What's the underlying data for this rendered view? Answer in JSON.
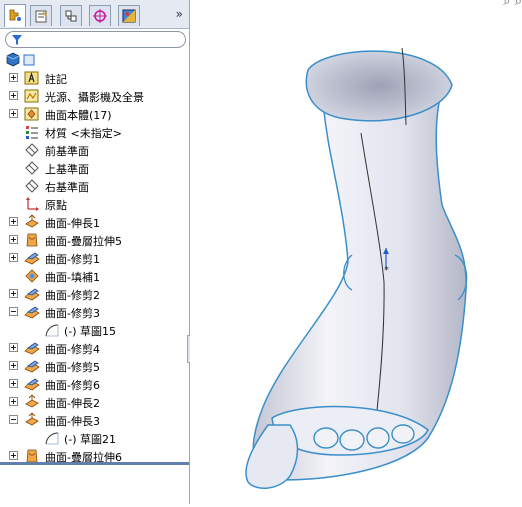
{
  "tabs": [
    {
      "name": "featuremanager",
      "icon": "feature-tree-icon"
    },
    {
      "name": "propertymanager",
      "icon": "property-manager-icon"
    },
    {
      "name": "configurationmanager",
      "icon": "configuration-icon"
    },
    {
      "name": "dimxpert",
      "icon": "target-icon"
    },
    {
      "name": "display",
      "icon": "display-manager-icon"
    }
  ],
  "more_tabs_glyph": "»",
  "tree": [
    {
      "label": "註記",
      "icon": "annotation-icon",
      "expander": "plus"
    },
    {
      "label": "光源、攝影機及全景",
      "icon": "lights-cameras-icon",
      "expander": "plus"
    },
    {
      "label": "曲面本體(17)",
      "icon": "surface-bodies-icon",
      "expander": "plus"
    },
    {
      "label": "材質 <未指定>",
      "icon": "material-icon",
      "expander": "none"
    },
    {
      "label": "前基準面",
      "icon": "plane-icon",
      "expander": "none"
    },
    {
      "label": "上基準面",
      "icon": "plane-icon",
      "expander": "none"
    },
    {
      "label": "右基準面",
      "icon": "plane-icon",
      "expander": "none"
    },
    {
      "label": "原點",
      "icon": "origin-icon",
      "expander": "none"
    },
    {
      "label": "曲面-伸長1",
      "icon": "surface-extrude-icon",
      "expander": "plus"
    },
    {
      "label": "曲面-疊層拉伸5",
      "icon": "surface-loft-icon",
      "expander": "plus"
    },
    {
      "label": "曲面-修剪1",
      "icon": "surface-trim-icon",
      "expander": "plus"
    },
    {
      "label": "曲面-填補1",
      "icon": "surface-fill-icon",
      "expander": "none"
    },
    {
      "label": "曲面-修剪2",
      "icon": "surface-trim-icon",
      "expander": "plus"
    },
    {
      "label": "曲面-修剪3",
      "icon": "surface-trim-icon",
      "expander": "minus"
    },
    {
      "label": "(-) 草圖15",
      "icon": "sketch-icon",
      "expander": "none",
      "indent": 1
    },
    {
      "label": "曲面-修剪4",
      "icon": "surface-trim-icon",
      "expander": "plus"
    },
    {
      "label": "曲面-修剪5",
      "icon": "surface-trim-icon",
      "expander": "plus"
    },
    {
      "label": "曲面-修剪6",
      "icon": "surface-trim-icon",
      "expander": "plus"
    },
    {
      "label": "曲面-伸長2",
      "icon": "surface-extrude-icon",
      "expander": "plus"
    },
    {
      "label": "曲面-伸長3",
      "icon": "surface-extrude-icon",
      "expander": "minus"
    },
    {
      "label": "(-) 草圖21",
      "icon": "sketch-icon",
      "expander": "none",
      "indent": 1
    },
    {
      "label": "曲面-疊層拉伸6",
      "icon": "surface-loft-icon",
      "expander": "plus"
    }
  ],
  "colors": {
    "accent": "#5f7fae",
    "model_edge": "#3a8fc9",
    "model_face": "#e6e8f2",
    "tree_line": "#b8b8b8"
  },
  "viewport": {
    "model": "foot-surface-model",
    "view_icons": "⌕ ⌕"
  }
}
